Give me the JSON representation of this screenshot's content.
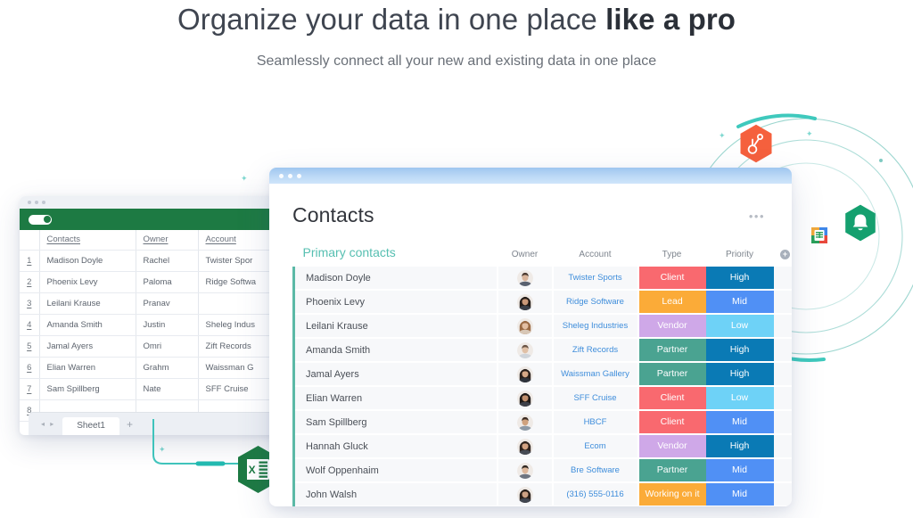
{
  "hero": {
    "headline_plain": "Organize your data in one place ",
    "headline_bold": "like a pro",
    "subhead": "Seamlessly connect all your new and existing data in one place"
  },
  "spreadsheet": {
    "app": "google-sheets",
    "toolbar_toggle": "",
    "columns": [
      "",
      "Contacts",
      "Owner",
      "Account"
    ],
    "rows": [
      {
        "n": "1",
        "contact": "Madison Doyle",
        "owner": "Rachel",
        "account": "Twister Spor"
      },
      {
        "n": "2",
        "contact": "Phoenix Levy",
        "owner": "Paloma",
        "account": "Ridge Softwa"
      },
      {
        "n": "3",
        "contact": "Leilani Krause",
        "owner": "Pranav",
        "account": ""
      },
      {
        "n": "4",
        "contact": "Amanda Smith",
        "owner": "Justin",
        "account": "Sheleg Indus"
      },
      {
        "n": "5",
        "contact": "Jamal Ayers",
        "owner": "Omri",
        "account": "Zift Records"
      },
      {
        "n": "6",
        "contact": "Elian Warren",
        "owner": "Grahm",
        "account": "Waissman G"
      },
      {
        "n": "7",
        "contact": "Sam Spillberg",
        "owner": "Nate",
        "account": "SFF Cruise"
      },
      {
        "n": "8",
        "contact": "",
        "owner": "",
        "account": ""
      }
    ],
    "tab_label": "Sheet1",
    "tab_arrows": "◂ ▸",
    "add_sheet": "+"
  },
  "contacts_card": {
    "title": "Contacts",
    "more_menu": "•••",
    "group_label": "Primary contacts",
    "columns": {
      "owner": "Owner",
      "account": "Account",
      "type": "Type",
      "priority": "Priority",
      "add": "+"
    },
    "colors": {
      "group_accent": "#56bfb1",
      "row_bar": "#5bb9a6",
      "link": "#3e8ddb",
      "Client": "#f9696f",
      "Lead": "#fbab38",
      "Vendor": "#cfa8e8",
      "Partner": "#4aa391",
      "Working on it": "#fbab38",
      "High": "#0a7ab5",
      "Mid": "#5090f5",
      "Low": "#6ed2f7"
    },
    "rows": [
      {
        "name": "Madison Doyle",
        "account": "Twister Sports",
        "type": "Client",
        "priority": "High",
        "avatar": "m1"
      },
      {
        "name": "Phoenix Levy",
        "account": "Ridge Software",
        "type": "Lead",
        "priority": "Mid",
        "avatar": "f1"
      },
      {
        "name": "Leilani Krause",
        "account": "Sheleg Industries",
        "type": "Vendor",
        "priority": "Low",
        "avatar": "f2"
      },
      {
        "name": "Amanda Smith",
        "account": "Zift Records",
        "type": "Partner",
        "priority": "High",
        "avatar": "m2"
      },
      {
        "name": "Jamal Ayers",
        "account": "Waissman Gallery",
        "type": "Partner",
        "priority": "High",
        "avatar": "f3"
      },
      {
        "name": "Elian Warren",
        "account": "SFF Cruise",
        "type": "Client",
        "priority": "Low",
        "avatar": "f4"
      },
      {
        "name": "Sam Spillberg",
        "account": "HBCF",
        "type": "Client",
        "priority": "Mid",
        "avatar": "m3"
      },
      {
        "name": "Hannah Gluck",
        "account": "Ecom",
        "type": "Vendor",
        "priority": "High",
        "avatar": "f5"
      },
      {
        "name": "Wolf Oppenhaim",
        "account": "Bre Software",
        "type": "Partner",
        "priority": "Mid",
        "avatar": "m4"
      },
      {
        "name": "John Walsh",
        "account": "(316) 555-0116",
        "type": "Working on it",
        "priority": "Mid",
        "avatar": "f6"
      }
    ]
  },
  "integrations": [
    {
      "name": "hubspot-icon",
      "color": "#f5603d"
    },
    {
      "name": "outlook-icon",
      "color": "#1b5f9e"
    },
    {
      "name": "google-sheets-icon",
      "color": "#1d9b55"
    },
    {
      "name": "bell-icon",
      "color": "#15a06f"
    },
    {
      "name": "excel-icon",
      "color": "#1d7a43"
    }
  ]
}
